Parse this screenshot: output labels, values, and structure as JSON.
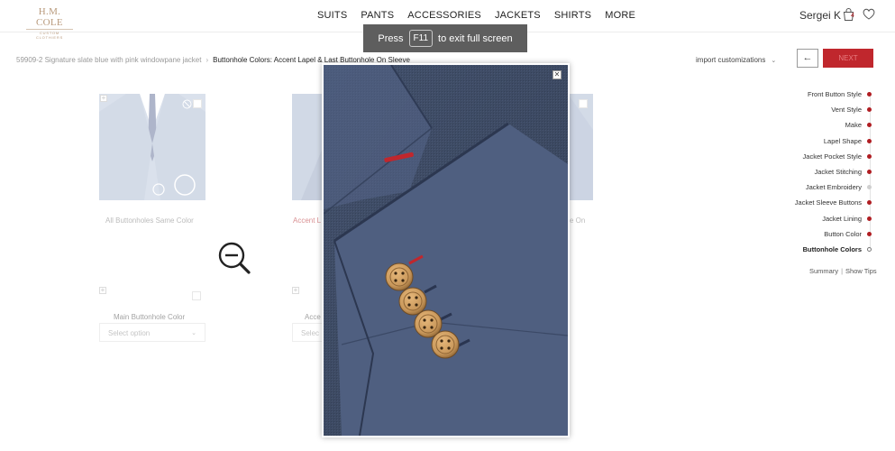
{
  "brand": {
    "line1": "H.M. COLE",
    "line2": "CUSTOM CLOTHIERS"
  },
  "nav": [
    "SUITS",
    "PANTS",
    "ACCESSORIES",
    "JACKETS",
    "SHIRTS",
    "MORE"
  ],
  "user": {
    "name": "Sergei K",
    "bag_count": "4"
  },
  "toast": {
    "pre": "Press",
    "key": "F11",
    "post": "to exit full screen"
  },
  "breadcrumb": {
    "parent": "59909-2 Signature slate blue with pink windowpane jacket",
    "current": "Buttonhole Colors: Accent Lapel & Last Buttonhole On Sleeve"
  },
  "import_label": "import customizations",
  "back_label": "←",
  "next_label": "NEXT",
  "steps": [
    {
      "label": "Front Button Style",
      "state": "done"
    },
    {
      "label": "Vent Style",
      "state": "done"
    },
    {
      "label": "Make",
      "state": "done"
    },
    {
      "label": "Lapel Shape",
      "state": "done"
    },
    {
      "label": "Jacket Pocket Style",
      "state": "done"
    },
    {
      "label": "Jacket Stitching",
      "state": "done"
    },
    {
      "label": "Jacket Embroidery",
      "state": "dim"
    },
    {
      "label": "Jacket Sleeve Buttons",
      "state": "done"
    },
    {
      "label": "Jacket Lining",
      "state": "done"
    },
    {
      "label": "Button Color",
      "state": "done"
    },
    {
      "label": "Buttonhole Colors",
      "state": "active"
    }
  ],
  "summary": {
    "summary_label": "Summary",
    "tips_label": "Show Tips"
  },
  "options": [
    {
      "label": "All Buttonholes Same Color",
      "sub_label": "Main Buttonhole Color",
      "select_placeholder": "Select option"
    },
    {
      "label": "Accent L",
      "sub_label": "Acce",
      "select_placeholder": "Selec"
    },
    {
      "label": "e On"
    }
  ],
  "colors": {
    "accent": "#c0272d",
    "fabric": "#4a5a78",
    "button": "#c8975a"
  }
}
